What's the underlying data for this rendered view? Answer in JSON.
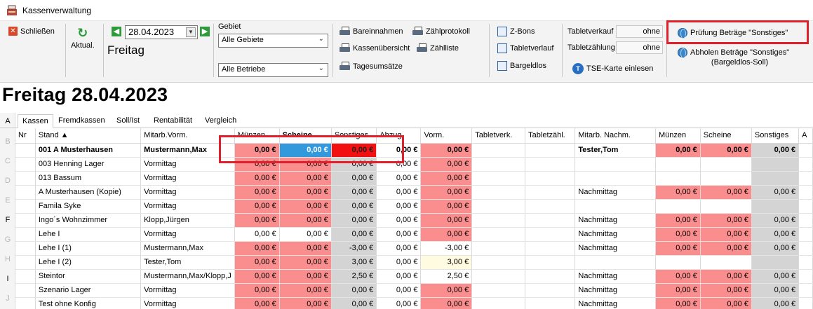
{
  "window": {
    "title": "Kassenverwaltung",
    "app_icon": "cash-register-icon"
  },
  "ribbon": {
    "close_label": "Schließen",
    "refresh_label": "Aktual.",
    "date_value": "28.04.2023",
    "day_label": "Freitag",
    "gebiet_label": "Gebiet",
    "gebiet_select": "Alle Gebiete",
    "betriebe_select": "Alle Betriebe",
    "reports": {
      "bareinnahmen": "Bareinnahmen",
      "kassenuebersicht": "Kassenübersicht",
      "tagesumsaetze": "Tagesumsätze",
      "zaehlprotokoll": "Zählprotokoll",
      "zaehlliste": "Zählliste"
    },
    "zbons": "Z-Bons",
    "tabletverlauf": "Tabletverlauf",
    "bargeldlos": "Bargeldlos",
    "tabletverkauf_label": "Tabletverkauf",
    "tabletverkauf_value": "ohne",
    "tabletzaehlung_label": "Tabletzählung",
    "tabletzaehlung_value": "ohne",
    "tse_label": "TSE-Karte einlesen",
    "pruefung_label": "Prüfung Beträge \"Sonstiges\"",
    "abholen_label_1": "Abholen Beträge \"Sonstiges\"",
    "abholen_label_2": "(Bargeldlos-Soll)"
  },
  "heading": "Freitag 28.04.2023",
  "tabs": [
    "Kassen",
    "Fremdkassen",
    "Soll/Ist",
    "Rentabilität",
    "Vergleich"
  ],
  "row_letters": [
    "A",
    "B",
    "C",
    "D",
    "E",
    "F",
    "G",
    "H",
    "I",
    "J"
  ],
  "grid": {
    "columns": [
      "Nr",
      "Stand ▲",
      "Mitarb.Vorm.",
      "Münzen",
      "Scheine",
      "Sonstiges",
      "Abzug",
      "Vorm.",
      "Tabletverk.",
      "Tabletzähl.",
      "Mitarb. Nachm.",
      "Münzen",
      "Scheine",
      "Sonstiges",
      "A"
    ],
    "rows": [
      {
        "nr": "",
        "stand": "001 A Musterhausen",
        "mitarb": "Mustermann,Max",
        "muenzen": "0,00 €",
        "scheine": "0,00 €",
        "sonstiges": "0,00 €",
        "abzug": "0,00 €",
        "vorm": "0,00 €",
        "tabletverk": "",
        "tabletzaehl": "",
        "nachm": "Tester,Tom",
        "muenzen2": "0,00 €",
        "scheine2": "0,00 €",
        "sonstiges2": "0,00 €"
      },
      {
        "nr": "",
        "stand": "003 Henning Lager",
        "mitarb": "Vormittag",
        "muenzen": "0,00 €",
        "scheine": "0,00 €",
        "sonstiges": "0,00 €",
        "abzug": "0,00 €",
        "vorm": "0,00 €",
        "tabletverk": "",
        "tabletzaehl": "",
        "nachm": "",
        "muenzen2": "",
        "scheine2": "",
        "sonstiges2": ""
      },
      {
        "nr": "",
        "stand": "013 Bassum",
        "mitarb": "Vormittag",
        "muenzen": "0,00 €",
        "scheine": "0,00 €",
        "sonstiges": "0,00 €",
        "abzug": "0,00 €",
        "vorm": "0,00 €",
        "tabletverk": "",
        "tabletzaehl": "",
        "nachm": "",
        "muenzen2": "",
        "scheine2": "",
        "sonstiges2": ""
      },
      {
        "nr": "",
        "stand": "A Musterhausen (Kopie)",
        "mitarb": "Vormittag",
        "muenzen": "0,00 €",
        "scheine": "0,00 €",
        "sonstiges": "0,00 €",
        "abzug": "0,00 €",
        "vorm": "0,00 €",
        "tabletverk": "",
        "tabletzaehl": "",
        "nachm": "Nachmittag",
        "muenzen2": "0,00 €",
        "scheine2": "0,00 €",
        "sonstiges2": "0,00 €"
      },
      {
        "nr": "",
        "stand": "Famila Syke",
        "mitarb": "Vormittag",
        "muenzen": "0,00 €",
        "scheine": "0,00 €",
        "sonstiges": "0,00 €",
        "abzug": "0,00 €",
        "vorm": "0,00 €",
        "tabletverk": "",
        "tabletzaehl": "",
        "nachm": "",
        "muenzen2": "",
        "scheine2": "",
        "sonstiges2": ""
      },
      {
        "nr": "",
        "stand": "Ingo´s Wohnzimmer",
        "mitarb": "Klopp,Jürgen",
        "muenzen": "0,00 €",
        "scheine": "0,00 €",
        "sonstiges": "0,00 €",
        "abzug": "0,00 €",
        "vorm": "0,00 €",
        "tabletverk": "",
        "tabletzaehl": "",
        "nachm": "Nachmittag",
        "muenzen2": "0,00 €",
        "scheine2": "0,00 €",
        "sonstiges2": "0,00 €"
      },
      {
        "nr": "",
        "stand": "Lehe I",
        "mitarb": "Vormittag",
        "muenzen": "0,00 €",
        "scheine": "0,00 €",
        "sonstiges": "0,00 €",
        "abzug": "0,00 €",
        "vorm": "0,00 €",
        "tabletverk": "",
        "tabletzaehl": "",
        "nachm": "Nachmittag",
        "muenzen2": "0,00 €",
        "scheine2": "0,00 €",
        "sonstiges2": "0,00 €"
      },
      {
        "nr": "",
        "stand": "Lehe I (1)",
        "mitarb": "Mustermann,Max",
        "muenzen": "0,00 €",
        "scheine": "0,00 €",
        "sonstiges": "-3,00 €",
        "abzug": "0,00 €",
        "vorm": "-3,00 €",
        "tabletverk": "",
        "tabletzaehl": "",
        "nachm": "Nachmittag",
        "muenzen2": "0,00 €",
        "scheine2": "0,00 €",
        "sonstiges2": "0,00 €"
      },
      {
        "nr": "",
        "stand": "Lehe I (2)",
        "mitarb": "Tester,Tom",
        "muenzen": "0,00 €",
        "scheine": "0,00 €",
        "sonstiges": "3,00 €",
        "abzug": "0,00 €",
        "vorm": "3,00 €",
        "tabletverk": "",
        "tabletzaehl": "",
        "nachm": "",
        "muenzen2": "",
        "scheine2": "",
        "sonstiges2": ""
      },
      {
        "nr": "",
        "stand": "Steintor",
        "mitarb": "Mustermann,Max/Klopp,J",
        "muenzen": "0,00 €",
        "scheine": "0,00 €",
        "sonstiges": "2,50 €",
        "abzug": "0,00 €",
        "vorm": "2,50 €",
        "tabletverk": "",
        "tabletzaehl": "",
        "nachm": "Nachmittag",
        "muenzen2": "0,00 €",
        "scheine2": "0,00 €",
        "sonstiges2": "0,00 €"
      },
      {
        "nr": "",
        "stand": "Szenario Lager",
        "mitarb": "Vormittag",
        "muenzen": "0,00 €",
        "scheine": "0,00 €",
        "sonstiges": "0,00 €",
        "abzug": "0,00 €",
        "vorm": "0,00 €",
        "tabletverk": "",
        "tabletzaehl": "",
        "nachm": "Nachmittag",
        "muenzen2": "0,00 €",
        "scheine2": "0,00 €",
        "sonstiges2": "0,00 €"
      },
      {
        "nr": "",
        "stand": "Test ohne Konfig",
        "mitarb": "Vormittag",
        "muenzen": "0,00 €",
        "scheine": "0,00 €",
        "sonstiges": "0,00 €",
        "abzug": "0,00 €",
        "vorm": "0,00 €",
        "tabletverk": "",
        "tabletzaehl": "",
        "nachm": "Nachmittag",
        "muenzen2": "0,00 €",
        "scheine2": "0,00 €",
        "sonstiges2": "0,00 €"
      }
    ]
  },
  "colors": {
    "cell_red": "#fa8d8d",
    "cell_gray": "#d4d4d4",
    "selected_blue": "#3399dd",
    "highlight_red": "#f21010",
    "annotation_red": "#e0202a",
    "ribbon_green": "#2d9b3b"
  }
}
